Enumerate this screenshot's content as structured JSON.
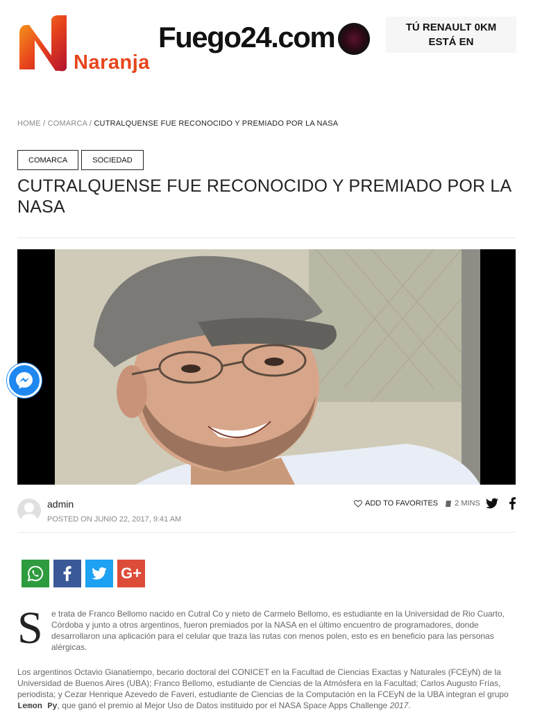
{
  "header": {
    "brand_logo": "Naranja",
    "banner_text": "Fuego24.com",
    "ad_line1": "TÚ RENAULT 0KM",
    "ad_line2": "ESTÁ EN"
  },
  "breadcrumb": {
    "home": "HOME",
    "section": "COMARCA",
    "current": "CUTRALQUENSE FUE RECONOCIDO Y PREMIADO POR LA NASA"
  },
  "tags": [
    "COMARCA",
    "SOCIEDAD"
  ],
  "article": {
    "title": "CUTRALQUENSE FUE RECONOCIDO Y PREMIADO POR LA NASA",
    "author": "admin",
    "posted": "POSTED ON JUNIO 22, 2017, 9:41 AM",
    "favorites_label": "ADD TO FAVORITES",
    "read_time": "2 MINS",
    "dropcap": "S",
    "paragraph1": "e trata de Franco Bellomo nacido en Cutral Co y nieto de Carmelo Bellomo, es estudiante en la Universidad de Rio Cuarto, Córdoba y junto a otros argentinos, fueron premiados por la NASA en el último encuentro de programadores, donde desarrollaron una aplicación para el celular que traza las rutas con menos polen, esto es en beneficio para las personas alérgicas.",
    "paragraph2_a": "Los argentinos Octavio Gianatiempo, becario doctoral del CONICET en la Facultad de Ciencias Exactas y Naturales (FCEyN) de la Universidad de Buenos Aires (UBA); Franco Bellomo, estudiante de Ciencias de la Atmósfera en la Facultad; Carlos Augusto Frías, periodista; y Cezar Henrique Azevedo de Faveri, estudiante de Ciencias de la Computación en la FCEyN de la UBA integran el grupo ",
    "paragraph2_team": "Lemon Py",
    "paragraph2_b": ", que ganó el premio al Mejor Uso de Datos instituido por el NASA Space Apps Challenge ",
    "paragraph2_year": "2017",
    "paragraph2_end": "."
  },
  "share": {
    "icons": [
      "whatsapp-icon",
      "facebook-icon",
      "twitter-icon",
      "google-plus-icon"
    ],
    "google_plus_label": "G+"
  },
  "colors": {
    "brand_orange": "#e8451c",
    "whatsapp": "#2e9b3e",
    "facebook": "#3b5998",
    "twitter": "#1da1f2",
    "google_plus": "#dd4b39",
    "messenger": "#1e88f0"
  }
}
